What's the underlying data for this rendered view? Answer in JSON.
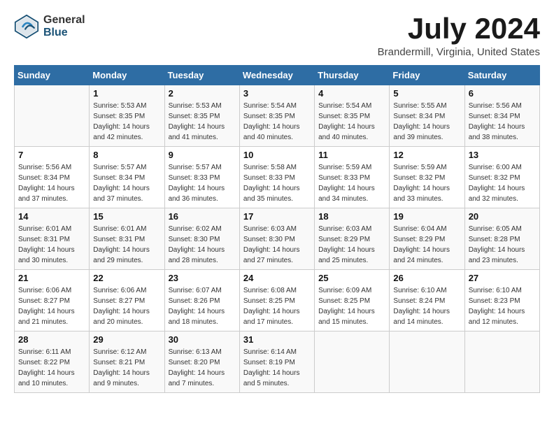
{
  "logo": {
    "line1": "General",
    "line2": "Blue"
  },
  "title": "July 2024",
  "subtitle": "Brandermill, Virginia, United States",
  "days_of_week": [
    "Sunday",
    "Monday",
    "Tuesday",
    "Wednesday",
    "Thursday",
    "Friday",
    "Saturday"
  ],
  "weeks": [
    [
      {
        "day": "",
        "info": ""
      },
      {
        "day": "1",
        "info": "Sunrise: 5:53 AM\nSunset: 8:35 PM\nDaylight: 14 hours\nand 42 minutes."
      },
      {
        "day": "2",
        "info": "Sunrise: 5:53 AM\nSunset: 8:35 PM\nDaylight: 14 hours\nand 41 minutes."
      },
      {
        "day": "3",
        "info": "Sunrise: 5:54 AM\nSunset: 8:35 PM\nDaylight: 14 hours\nand 40 minutes."
      },
      {
        "day": "4",
        "info": "Sunrise: 5:54 AM\nSunset: 8:35 PM\nDaylight: 14 hours\nand 40 minutes."
      },
      {
        "day": "5",
        "info": "Sunrise: 5:55 AM\nSunset: 8:34 PM\nDaylight: 14 hours\nand 39 minutes."
      },
      {
        "day": "6",
        "info": "Sunrise: 5:56 AM\nSunset: 8:34 PM\nDaylight: 14 hours\nand 38 minutes."
      }
    ],
    [
      {
        "day": "7",
        "info": "Sunrise: 5:56 AM\nSunset: 8:34 PM\nDaylight: 14 hours\nand 37 minutes."
      },
      {
        "day": "8",
        "info": "Sunrise: 5:57 AM\nSunset: 8:34 PM\nDaylight: 14 hours\nand 37 minutes."
      },
      {
        "day": "9",
        "info": "Sunrise: 5:57 AM\nSunset: 8:33 PM\nDaylight: 14 hours\nand 36 minutes."
      },
      {
        "day": "10",
        "info": "Sunrise: 5:58 AM\nSunset: 8:33 PM\nDaylight: 14 hours\nand 35 minutes."
      },
      {
        "day": "11",
        "info": "Sunrise: 5:59 AM\nSunset: 8:33 PM\nDaylight: 14 hours\nand 34 minutes."
      },
      {
        "day": "12",
        "info": "Sunrise: 5:59 AM\nSunset: 8:32 PM\nDaylight: 14 hours\nand 33 minutes."
      },
      {
        "day": "13",
        "info": "Sunrise: 6:00 AM\nSunset: 8:32 PM\nDaylight: 14 hours\nand 32 minutes."
      }
    ],
    [
      {
        "day": "14",
        "info": "Sunrise: 6:01 AM\nSunset: 8:31 PM\nDaylight: 14 hours\nand 30 minutes."
      },
      {
        "day": "15",
        "info": "Sunrise: 6:01 AM\nSunset: 8:31 PM\nDaylight: 14 hours\nand 29 minutes."
      },
      {
        "day": "16",
        "info": "Sunrise: 6:02 AM\nSunset: 8:30 PM\nDaylight: 14 hours\nand 28 minutes."
      },
      {
        "day": "17",
        "info": "Sunrise: 6:03 AM\nSunset: 8:30 PM\nDaylight: 14 hours\nand 27 minutes."
      },
      {
        "day": "18",
        "info": "Sunrise: 6:03 AM\nSunset: 8:29 PM\nDaylight: 14 hours\nand 25 minutes."
      },
      {
        "day": "19",
        "info": "Sunrise: 6:04 AM\nSunset: 8:29 PM\nDaylight: 14 hours\nand 24 minutes."
      },
      {
        "day": "20",
        "info": "Sunrise: 6:05 AM\nSunset: 8:28 PM\nDaylight: 14 hours\nand 23 minutes."
      }
    ],
    [
      {
        "day": "21",
        "info": "Sunrise: 6:06 AM\nSunset: 8:27 PM\nDaylight: 14 hours\nand 21 minutes."
      },
      {
        "day": "22",
        "info": "Sunrise: 6:06 AM\nSunset: 8:27 PM\nDaylight: 14 hours\nand 20 minutes."
      },
      {
        "day": "23",
        "info": "Sunrise: 6:07 AM\nSunset: 8:26 PM\nDaylight: 14 hours\nand 18 minutes."
      },
      {
        "day": "24",
        "info": "Sunrise: 6:08 AM\nSunset: 8:25 PM\nDaylight: 14 hours\nand 17 minutes."
      },
      {
        "day": "25",
        "info": "Sunrise: 6:09 AM\nSunset: 8:25 PM\nDaylight: 14 hours\nand 15 minutes."
      },
      {
        "day": "26",
        "info": "Sunrise: 6:10 AM\nSunset: 8:24 PM\nDaylight: 14 hours\nand 14 minutes."
      },
      {
        "day": "27",
        "info": "Sunrise: 6:10 AM\nSunset: 8:23 PM\nDaylight: 14 hours\nand 12 minutes."
      }
    ],
    [
      {
        "day": "28",
        "info": "Sunrise: 6:11 AM\nSunset: 8:22 PM\nDaylight: 14 hours\nand 10 minutes."
      },
      {
        "day": "29",
        "info": "Sunrise: 6:12 AM\nSunset: 8:21 PM\nDaylight: 14 hours\nand 9 minutes."
      },
      {
        "day": "30",
        "info": "Sunrise: 6:13 AM\nSunset: 8:20 PM\nDaylight: 14 hours\nand 7 minutes."
      },
      {
        "day": "31",
        "info": "Sunrise: 6:14 AM\nSunset: 8:19 PM\nDaylight: 14 hours\nand 5 minutes."
      },
      {
        "day": "",
        "info": ""
      },
      {
        "day": "",
        "info": ""
      },
      {
        "day": "",
        "info": ""
      }
    ]
  ]
}
